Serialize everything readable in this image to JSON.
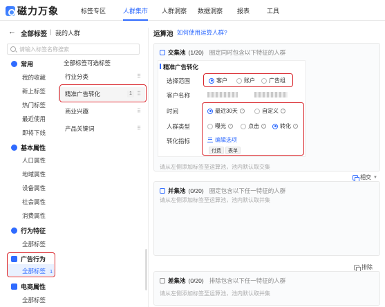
{
  "logo": {
    "text": "磁力万象"
  },
  "nav": {
    "items": [
      "标签专区",
      "人群集市",
      "人群洞察",
      "数据洞察",
      "报表",
      "工具"
    ],
    "active_index": 1
  },
  "header": {
    "back_icon": "arrow-left-icon",
    "title": "全部标签",
    "separator": "|",
    "subtitle": "我的人群"
  },
  "search": {
    "placeholder": "请输入标签名称搜索"
  },
  "categories": {
    "groups": [
      {
        "label": "常用",
        "items": [
          "我的收藏",
          "新上标签",
          "热门标签",
          "最近使用",
          "即将下线"
        ]
      },
      {
        "label": "基本属性",
        "items": [
          "人口属性",
          "地域属性",
          "设备属性",
          "社会属性",
          "消费属性"
        ]
      },
      {
        "label": "行为特征",
        "items": [
          "全部标签"
        ]
      },
      {
        "label": "广告行为",
        "items": [
          "全部标签"
        ],
        "active_item_count": "1"
      },
      {
        "label": "电商属性",
        "items": [
          "全部标签"
        ]
      }
    ]
  },
  "middle": {
    "title": "全部标签可选标签",
    "items": [
      {
        "label": "行业分类",
        "count": ""
      },
      {
        "label": "精准广告转化",
        "count": "1"
      },
      {
        "label": "商业兴趣",
        "count": ""
      },
      {
        "label": "产品关键词",
        "count": ""
      }
    ]
  },
  "pool": {
    "title": "运算池",
    "help_link": "如何使用运算人群?",
    "intersection": {
      "title": "交集池",
      "count": "(1/20)",
      "desc": "圈定同时包含以下特征的人群",
      "hint": "请从左侧添加标签至运算池，池内默认取交集",
      "toggle_label": "相交"
    },
    "card": {
      "title": "精准广告转化",
      "scope_label": "选择范围",
      "scope_options": [
        "客户",
        "账户",
        "广告组"
      ],
      "scope_selected": 0,
      "customer_label": "客户名称",
      "time_label": "时间",
      "time_options": [
        "最近30天",
        "自定义"
      ],
      "time_selected": 0,
      "crowd_label": "人群类型",
      "crowd_options": [
        "曝光",
        "点击",
        "转化"
      ],
      "crowd_selected": 2,
      "metric_label": "转化指标",
      "edit_label": "编辑选项",
      "tags": [
        "付费",
        "表单"
      ]
    },
    "union": {
      "title": "并集池",
      "count": "(0/20)",
      "desc": "圈定包含以下任一特征的人群",
      "hint": "请从左侧添加标签至运算池，池内默认取并集"
    },
    "exclude": {
      "toggle_label": "排除",
      "title": "差集池",
      "count": "(0/20)",
      "desc": "排除包含以下任一特征的人群",
      "hint": "请从左侧添加标签至运算池，池内默认取并集"
    }
  }
}
